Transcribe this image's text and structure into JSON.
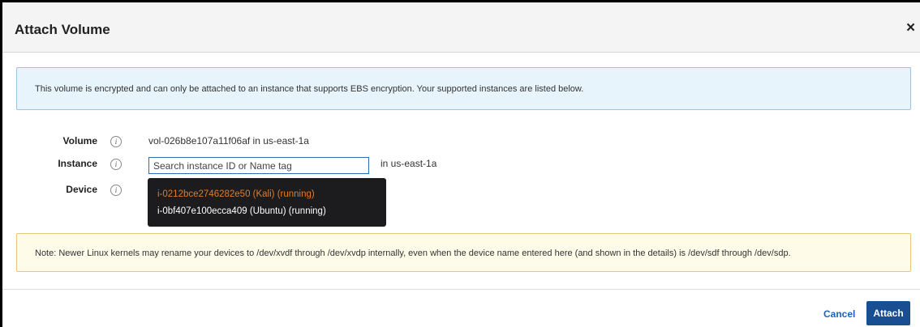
{
  "dialog": {
    "title": "Attach Volume",
    "close_label": "×"
  },
  "info_message": "This volume is encrypted and can only be attached to an instance that supports EBS encryption. Your supported instances are listed below.",
  "form": {
    "volume_label": "Volume",
    "volume_value": "vol-026b8e107a11f06af in us-east-1a",
    "instance_label": "Instance",
    "instance_placeholder": "Search instance ID or Name tag",
    "instance_suffix": "in us-east-1a",
    "device_label": "Device",
    "info_glyph": "i"
  },
  "dropdown": {
    "items": [
      {
        "label": "i-0212bce2746282e50 (Kali) (running)",
        "highlighted": true
      },
      {
        "label": "i-0bf407e100ecca409 (Ubuntu) (running)",
        "highlighted": false
      }
    ]
  },
  "note_message": "Note: Newer Linux kernels may rename your devices to /dev/xvdf through /dev/xvdp internally, even when the device name entered here (and shown in the details) is /dev/sdf through /dev/sdp.",
  "footer": {
    "cancel_label": "Cancel",
    "attach_label": "Attach"
  },
  "colors": {
    "primary": "#1a4e92",
    "link": "#1f64b3",
    "highlight": "#e07c2a",
    "info_bg": "#e8f4fb",
    "note_bg": "#fefbe9"
  }
}
